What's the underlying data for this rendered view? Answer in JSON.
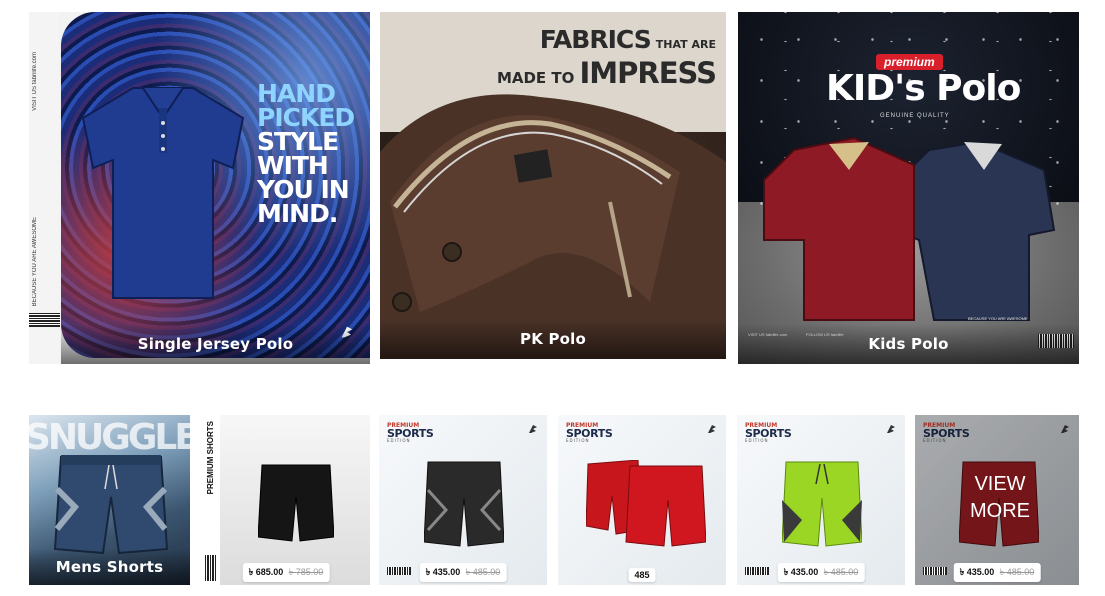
{
  "polo_categories": [
    {
      "label": "Single Jersey Polo",
      "headline": [
        "HAND",
        "PICKED",
        "STYLE",
        "WITH",
        "YOU IN",
        "MIND."
      ],
      "side_text_top": "VISIT US fabrilife.com",
      "side_text_bottom": "BECAUSE YOU ARE AWESOME"
    },
    {
      "label": "PK Polo",
      "headline_a": "FABRICS",
      "headline_a_small": "THAT ARE",
      "headline_b_small": "MADE TO",
      "headline_b": "IMPRESS"
    },
    {
      "label": "Kids Polo",
      "ribbon": "premium",
      "title": "KID's Polo",
      "subtitle": "GENUINE QUALITY",
      "footer_left": "VISIT US fabrilife.com",
      "footer_mid": "FOLLOW US fabrilife",
      "footer_right": "BECAUSE YOU ARE AWESOME"
    }
  ],
  "shorts": {
    "category_label": "Mens Shorts",
    "banner_word": "SNUGGLE",
    "premium_shorts_label": "PREMIUM SHORTS",
    "premium_sports": {
      "line1": "PREMIUM",
      "line2": "SPORTS",
      "line3": "EDITION"
    },
    "products": [
      {
        "price": "৳ 685.00",
        "old_price": "৳ 785.00",
        "color": "#151515"
      },
      {
        "price": "৳ 435.00",
        "old_price": "৳ 485.00",
        "color": "#2a2a2a"
      },
      {
        "price": "485",
        "old_price": "",
        "color": "#c8161d"
      },
      {
        "price": "৳ 435.00",
        "old_price": "৳ 485.00",
        "color": "#9ad623"
      },
      {
        "price": "৳ 435.00",
        "old_price": "৳ 485.00",
        "color": "#8e1b1f"
      }
    ],
    "view_more": [
      "VIEW",
      "MORE"
    ]
  }
}
